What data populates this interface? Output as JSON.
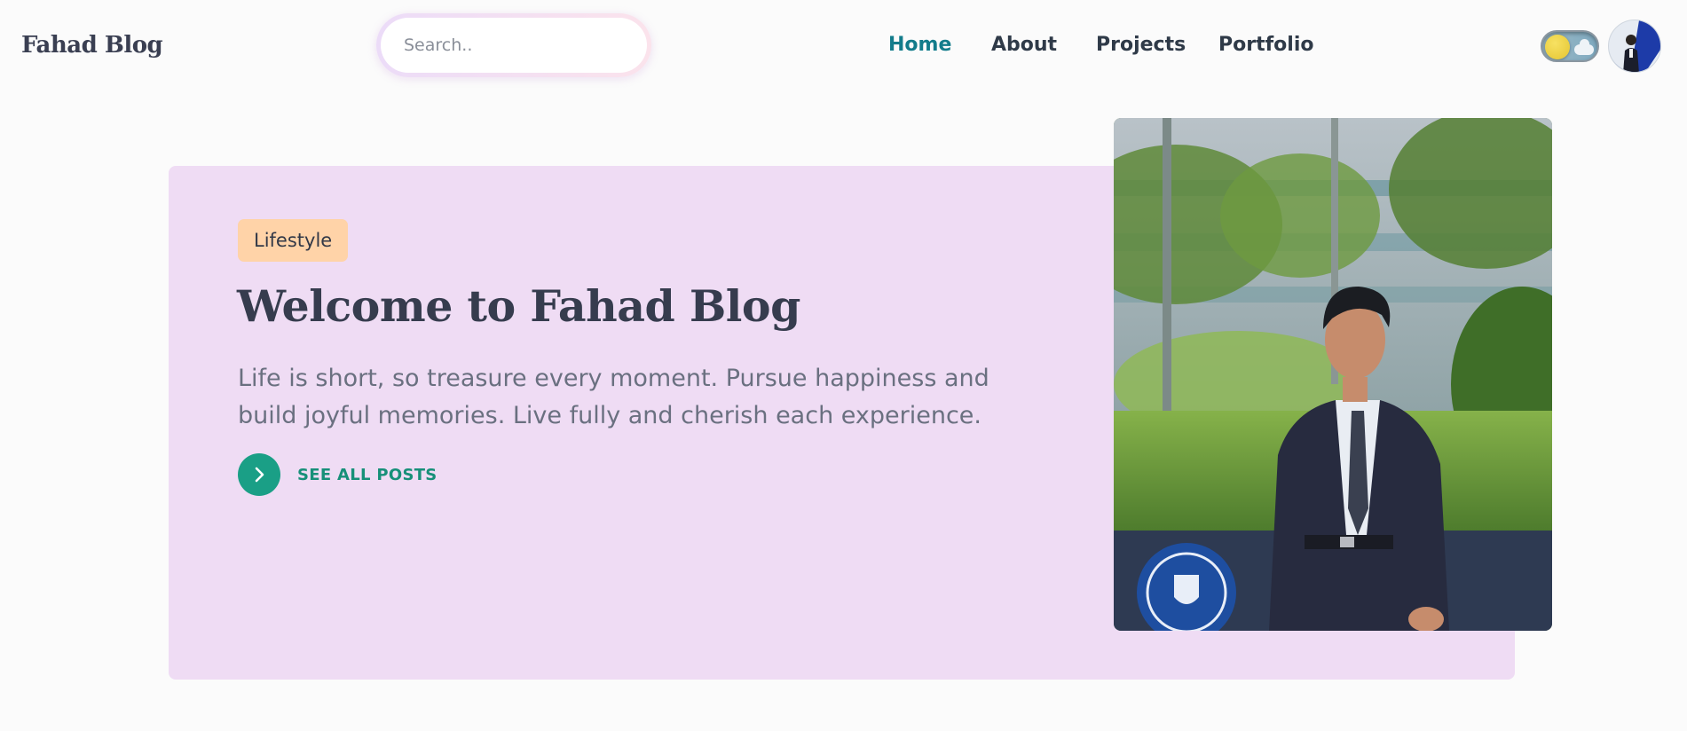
{
  "header": {
    "brand": "Fahad Blog",
    "search": {
      "placeholder": "Search..",
      "value": ""
    },
    "nav": [
      {
        "label": "Home",
        "active": true
      },
      {
        "label": "About",
        "active": false
      },
      {
        "label": "Projects",
        "active": false
      },
      {
        "label": "Portfolio",
        "active": false
      }
    ],
    "theme_toggle": {
      "state": "light",
      "icon": "sun-cloud-icon"
    },
    "avatar": {
      "icon": "user-avatar"
    }
  },
  "hero": {
    "badge": "Lifestyle",
    "title": "Welcome to Fahad Blog",
    "description": "Life is short, so treasure every moment. Pursue happiness and build joyful memories. Live fully and cherish each experience.",
    "cta_label": "SEE ALL POSTS",
    "cta_icon": "chevron-right-icon",
    "photo": "portrait-photo"
  },
  "colors": {
    "page_bg": "#fbfbfb",
    "hero_bg": "#efdcf4",
    "badge_bg": "#ffd3a8",
    "accent": "#1a9f86",
    "nav_active": "#137c8b",
    "text_dark": "#363c4e"
  }
}
